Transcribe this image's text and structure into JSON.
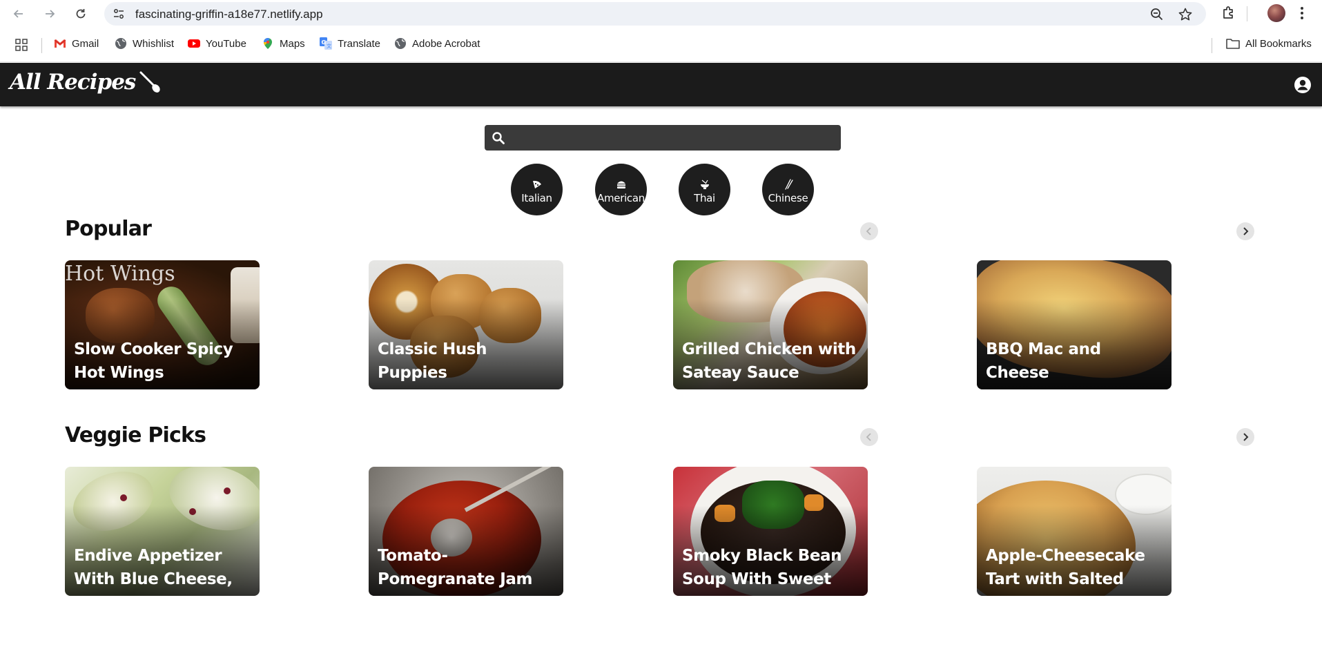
{
  "browser": {
    "url": "fascinating-griffin-a18e77.netlify.app",
    "bookmarks": [
      {
        "label": "Gmail",
        "icon": "gmail-icon"
      },
      {
        "label": "Whishlist",
        "icon": "globe-icon"
      },
      {
        "label": "YouTube",
        "icon": "youtube-icon"
      },
      {
        "label": "Maps",
        "icon": "maps-icon"
      },
      {
        "label": "Translate",
        "icon": "translate-icon"
      },
      {
        "label": "Adobe Acrobat",
        "icon": "globe-icon"
      }
    ],
    "all_bookmarks_label": "All Bookmarks"
  },
  "header": {
    "logo_text": "All Recipes"
  },
  "search": {
    "value": "",
    "placeholder": ""
  },
  "categories": [
    {
      "label": "Italian",
      "icon": "pizza-icon"
    },
    {
      "label": "American",
      "icon": "burger-icon"
    },
    {
      "label": "Thai",
      "icon": "noodle-bowl-icon"
    },
    {
      "label": "Chinese",
      "icon": "chopsticks-icon"
    }
  ],
  "sections": [
    {
      "title": "Popular",
      "cards": [
        {
          "title": "Slow Cooker Spicy Hot Wings",
          "alt_text": "Hot Wings"
        },
        {
          "title": "Classic Hush Puppies"
        },
        {
          "title": "Grilled Chicken with Sateay Sauce"
        },
        {
          "title": "BBQ Mac and Cheese"
        }
      ]
    },
    {
      "title": "Veggie Picks",
      "cards": [
        {
          "title": "Endive Appetizer With Blue Cheese,"
        },
        {
          "title": "Tomato-Pomegranate Jam"
        },
        {
          "title": "Smoky Black Bean Soup With Sweet"
        },
        {
          "title": "Apple-Cheesecake Tart with Salted"
        }
      ]
    }
  ],
  "colors": {
    "header_bg": "#1b1b1b",
    "search_bg": "#3a3a3a",
    "category_bg": "#1e1e1e"
  }
}
